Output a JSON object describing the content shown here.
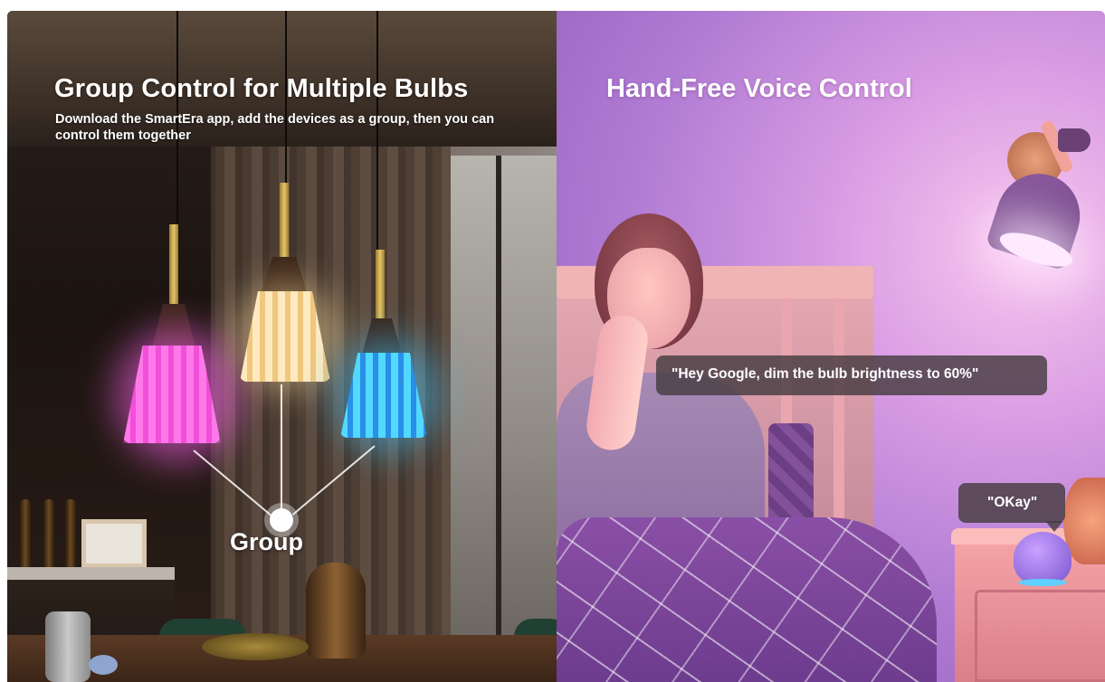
{
  "left_panel": {
    "title": "Group Control for Multiple Bulbs",
    "subtitle": "Download the SmartEra app, add the devices as a group, then you can control them together",
    "group_label": "Group",
    "bulb_colors": [
      "#ff6ef0",
      "#ffe2a8",
      "#48c9ff"
    ]
  },
  "right_panel": {
    "title": "Hand-Free Voice Control",
    "voice_command": "\"Hey Google, dim the bulb brightness to 60%\"",
    "voice_response": "\"OKay\""
  }
}
